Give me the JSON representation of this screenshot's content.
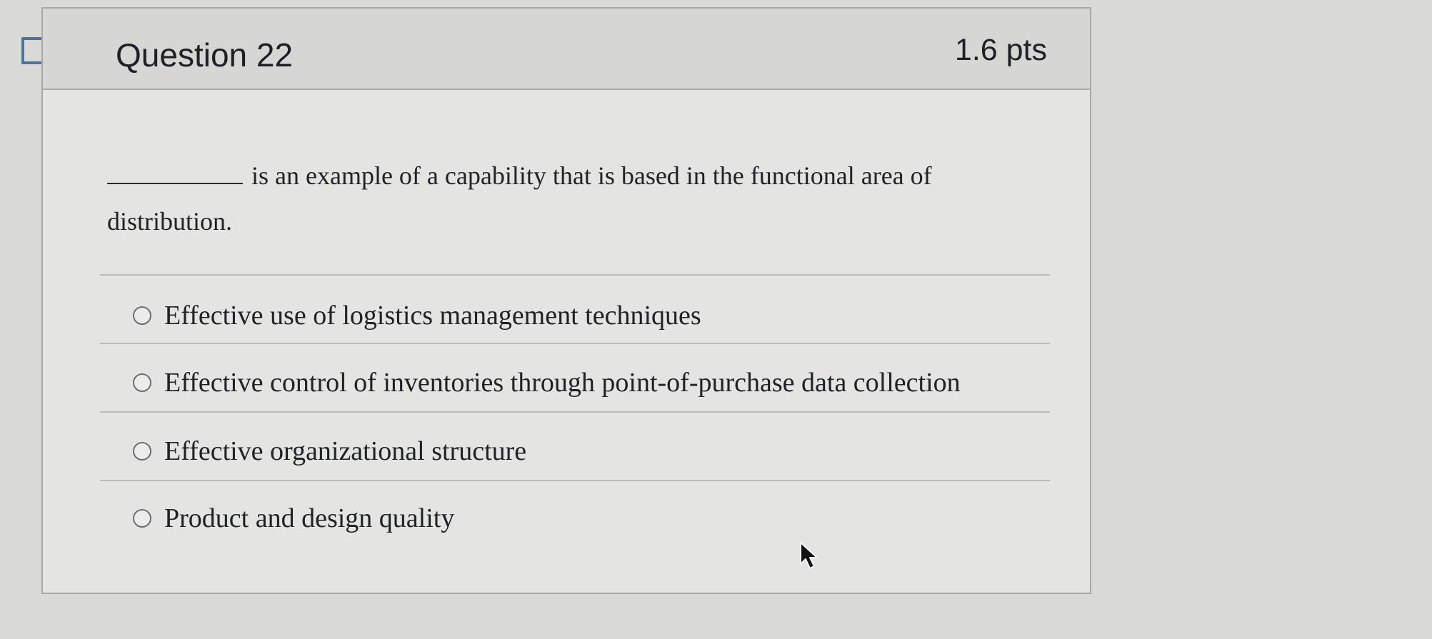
{
  "question": {
    "title": "Question 22",
    "points": "1.6 pts",
    "text_before": "",
    "text": "is an example of a capability that is based in the functional area of distribution.",
    "flag_icon": "flag-icon"
  },
  "answers": [
    {
      "label": "Effective use of logistics management techniques"
    },
    {
      "label": "Effective control of inventories through point-of-purchase data collection"
    },
    {
      "label": "Effective organizational structure"
    },
    {
      "label": "Product and design quality"
    }
  ],
  "colors": {
    "background": "#d9d9d7",
    "card": "#e4e4e2",
    "header": "#d6d6d4",
    "text": "#1f2326"
  }
}
